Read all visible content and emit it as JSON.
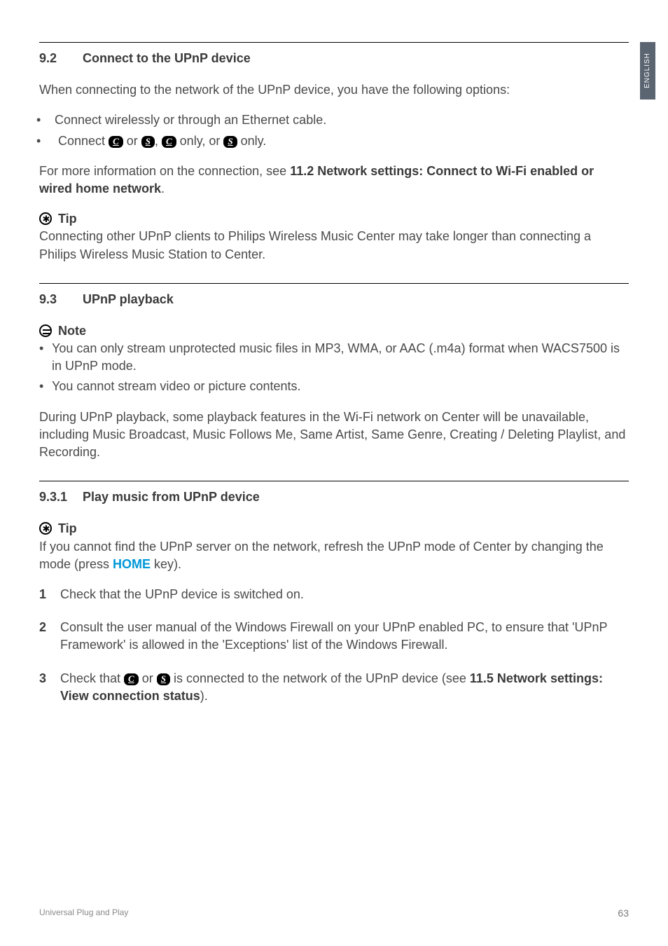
{
  "sideTab": "ENGLISH",
  "s92": {
    "num": "9.2",
    "title": "Connect to the UPnP device",
    "intro": "When connecting to the network of the UPnP device, you have the following options:",
    "bullet1": "Connect wirelessly or through an Ethernet cable.",
    "bullet2a": "Connect ",
    "bullet2b": " or ",
    "bullet2c": ", ",
    "bullet2d": " only, or ",
    "bullet2e": " only.",
    "more1": "For more information on the connection, see ",
    "moreBold": "11.2 Network settings: Connect to Wi-Fi enabled or wired home network",
    "more2": ".",
    "tipLabel": "Tip",
    "tipBody": "Connecting other UPnP clients to Philips Wireless Music Center may take longer than connecting a Philips Wireless Music Station to Center."
  },
  "s93": {
    "num": "9.3",
    "title": "UPnP playback",
    "noteLabel": "Note",
    "note1": "You can only stream unprotected music files in MP3, WMA, or AAC (.m4a) format when WACS7500 is in UPnP mode.",
    "note2": "You cannot stream video or picture contents.",
    "para": "During UPnP playback, some playback features in the Wi-Fi network on Center will be unavailable, including Music Broadcast, Music Follows Me, Same Artist, Same Genre, Creating / Deleting Playlist, and Recording."
  },
  "s931": {
    "num": "9.3.1",
    "title": "Play music from UPnP device",
    "tipLabel": "Tip",
    "tip1": "If you cannot find the UPnP server on the network, refresh the UPnP mode of Center by changing the mode (press ",
    "homeKey": "HOME",
    "tip2": " key).",
    "step1": "Check that the UPnP device is switched on.",
    "step2": "Consult the user manual of the Windows Firewall on your UPnP enabled PC, to ensure that 'UPnP Framework' is allowed in the 'Exceptions' list of the Windows Firewall.",
    "step3a": "Check that ",
    "step3b": " or ",
    "step3c": " is connected to the network of the UPnP device (see ",
    "step3bold": "11.5 Network settings: View connection status",
    "step3d": ")."
  },
  "keys": {
    "C": "C",
    "S": "S"
  },
  "footer": {
    "left": "Universal Plug and Play",
    "page": "63"
  }
}
